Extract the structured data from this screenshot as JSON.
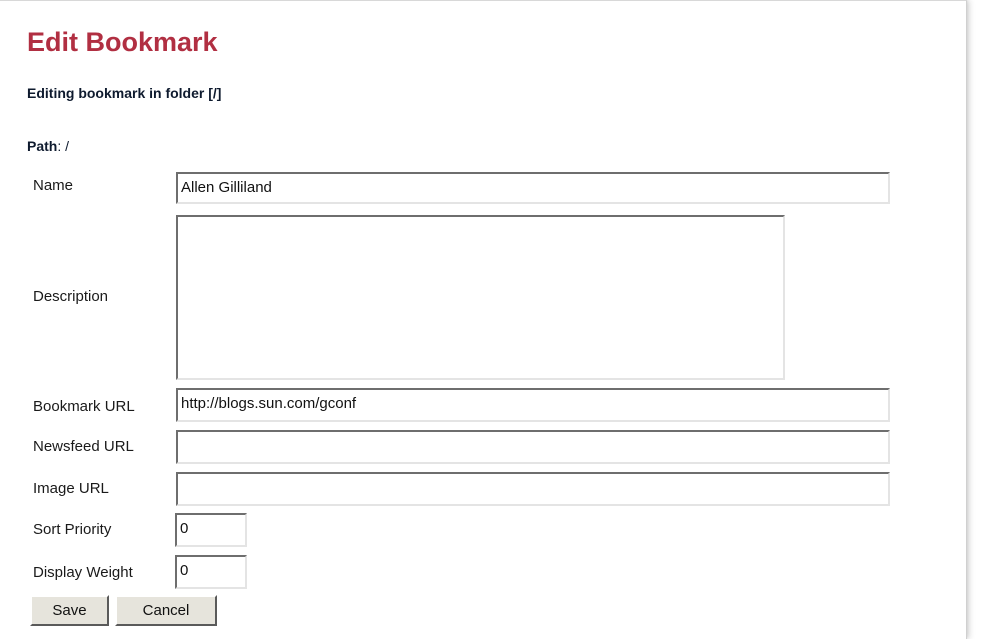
{
  "page": {
    "title": "Edit Bookmark",
    "subtitle": "Editing bookmark in folder [/]",
    "path_label": "Path",
    "path_value": ": /"
  },
  "form": {
    "name": {
      "label": "Name",
      "value": "Allen Gilliland"
    },
    "description": {
      "label": "Description",
      "value": ""
    },
    "bookmark_url": {
      "label": "Bookmark URL",
      "value": "http://blogs.sun.com/gconf"
    },
    "newsfeed_url": {
      "label": "Newsfeed URL",
      "value": ""
    },
    "image_url": {
      "label": "Image URL",
      "value": ""
    },
    "sort_priority": {
      "label": "Sort Priority",
      "value": "0"
    },
    "display_weight": {
      "label": "Display Weight",
      "value": "0"
    }
  },
  "buttons": {
    "save": "Save",
    "cancel": "Cancel"
  },
  "colors": {
    "title": "#b12f42",
    "subtitle": "#0e1a2e"
  }
}
